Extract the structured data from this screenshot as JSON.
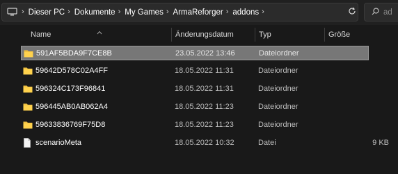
{
  "address_bar": {
    "breadcrumbs": [
      "Dieser PC",
      "Dokumente",
      "My Games",
      "ArmaReforger",
      "addons"
    ],
    "chevron_glyph": "›",
    "pc_icon": "monitor-icon",
    "refresh_icon": "refresh-icon"
  },
  "search": {
    "placeholder": "ad",
    "icon": "search-icon"
  },
  "columns": {
    "name": "Name",
    "date": "Änderungsdatum",
    "type": "Typ",
    "size": "Größe"
  },
  "rows": [
    {
      "name": "591AF5BDA9F7CE8B",
      "date": "23.05.2022 13:46",
      "type": "Dateiordner",
      "size": "",
      "icon": "folder-icon",
      "selected": true
    },
    {
      "name": "59642D578C02A4FF",
      "date": "18.05.2022 11:31",
      "type": "Dateiordner",
      "size": "",
      "icon": "folder-icon",
      "selected": false
    },
    {
      "name": "596324C173F96841",
      "date": "18.05.2022 11:31",
      "type": "Dateiordner",
      "size": "",
      "icon": "folder-icon",
      "selected": false
    },
    {
      "name": "596445AB0AB062A4",
      "date": "18.05.2022 11:23",
      "type": "Dateiordner",
      "size": "",
      "icon": "folder-icon",
      "selected": false
    },
    {
      "name": "59633836769F75D8",
      "date": "18.05.2022 11:23",
      "type": "Dateiordner",
      "size": "",
      "icon": "folder-icon",
      "selected": false
    },
    {
      "name": "scenarioMeta",
      "date": "18.05.2022 10:32",
      "type": "Datei",
      "size": "9 KB",
      "icon": "file-icon",
      "selected": false
    }
  ],
  "colors": {
    "background": "#191919",
    "selection": "#777777",
    "folder": "#f0c040"
  }
}
